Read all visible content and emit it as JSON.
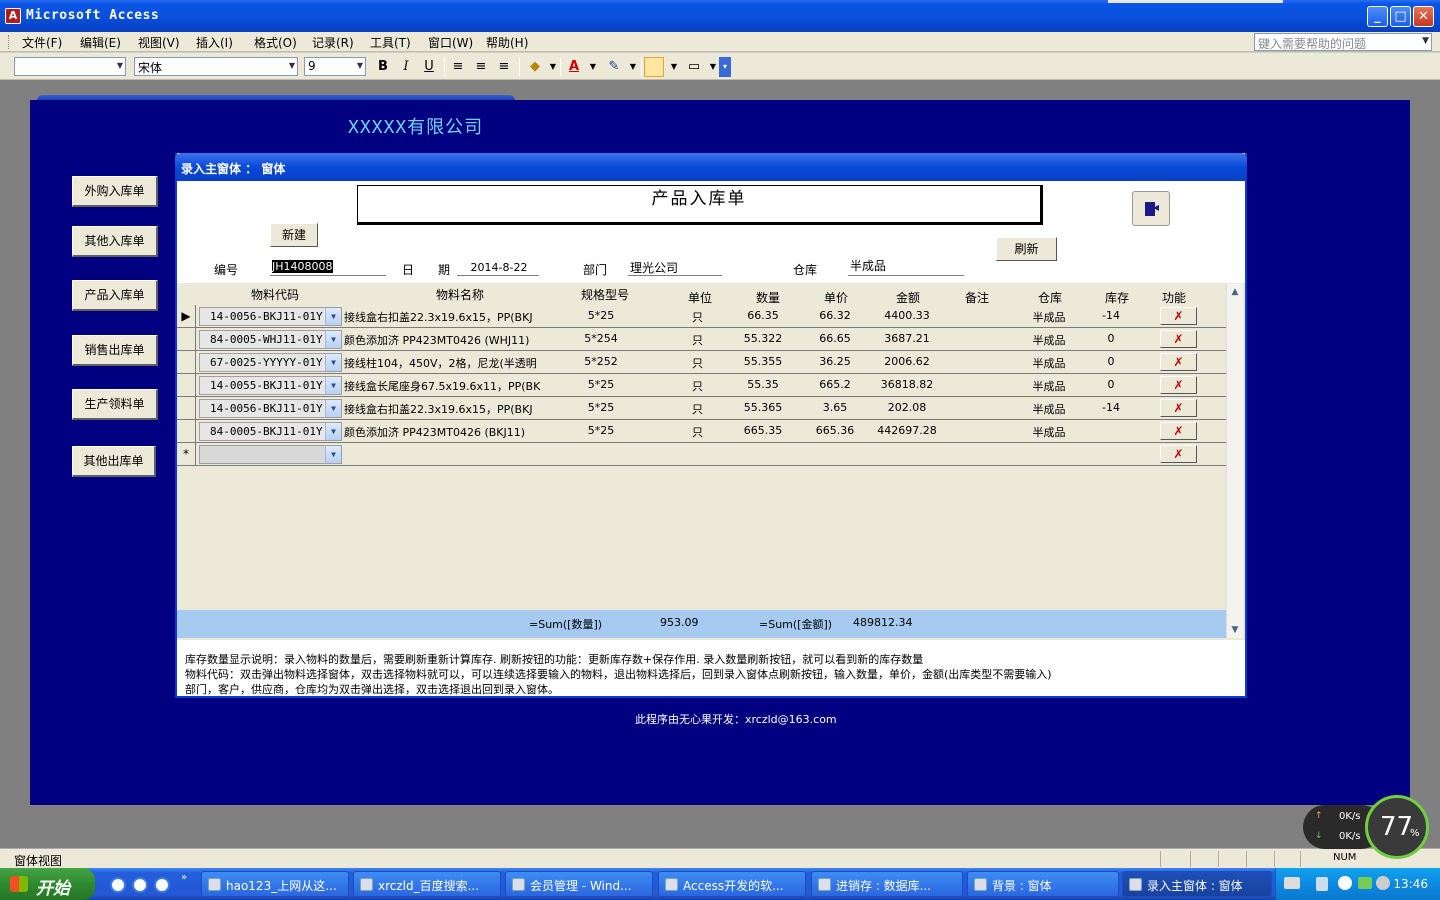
{
  "window": {
    "title": "Microsoft Access",
    "app_icon": "A"
  },
  "menu": {
    "items": [
      "文件(F)",
      "编辑(E)",
      "视图(V)",
      "插入(I)",
      "格式(O)",
      "记录(R)",
      "工具(T)",
      "窗口(W)",
      "帮助(H)"
    ],
    "help_placeholder": "键入需要帮助的问题"
  },
  "toolbar": {
    "object_combo": "",
    "font": "宋体",
    "size": "9",
    "bold": "B",
    "italic": "I",
    "underline": "U"
  },
  "background_form": {
    "company": "XXXXX有限公司",
    "footer": "此程序由无心果开发：xrczld@163.com"
  },
  "nav_buttons": [
    "外购入库单",
    "其他入库单",
    "产品入库单",
    "销售出库单",
    "生产领料单",
    "其他出库单"
  ],
  "form": {
    "window_title": "录入主窗体 ： 窗体",
    "title": "产品入库单",
    "new_button": "新建",
    "refresh_button": "刷新",
    "fields": {
      "code_label": "编号",
      "code_value": "JH1408008",
      "date_label_1": "日",
      "date_label_2": "期",
      "date_value": "2014-8-22",
      "dept_label": "部门",
      "dept_value": "理光公司",
      "warehouse_label": "仓库",
      "warehouse_value": "半成品"
    },
    "columns": [
      "物料代码",
      "物料名称",
      "规格型号",
      "单位",
      "数量",
      "单价",
      "金额",
      "备注",
      "仓库",
      "库存",
      "功能"
    ],
    "rows": [
      {
        "code": "14-0056-BKJ11-01Y",
        "name": "接线盒右扣盖22.3x19.6x15，PP(BKJ",
        "spec": "5*25",
        "unit": "只",
        "qty": "66.35",
        "price": "66.32",
        "amount": "4400.33",
        "note": "",
        "wh": "半成品",
        "stock": "-14"
      },
      {
        "code": "84-0005-WHJ11-01Y",
        "name": "颜色添加济 PP423MT0426 (WHJ11)",
        "spec": "5*254",
        "unit": "只",
        "qty": "55.322",
        "price": "66.65",
        "amount": "3687.21",
        "note": "",
        "wh": "半成品",
        "stock": "0"
      },
      {
        "code": "67-0025-YYYYY-01Y",
        "name": "接线柱104，450V，2格，尼龙(半透明",
        "spec": "5*252",
        "unit": "只",
        "qty": "55.355",
        "price": "36.25",
        "amount": "2006.62",
        "note": "",
        "wh": "半成品",
        "stock": "0"
      },
      {
        "code": "14-0055-BKJ11-01Y",
        "name": "接线盒长尾座身67.5x19.6x11，PP(BK",
        "spec": "5*25",
        "unit": "只",
        "qty": "55.35",
        "price": "665.2",
        "amount": "36818.82",
        "note": "",
        "wh": "半成品",
        "stock": "0"
      },
      {
        "code": "14-0056-BKJ11-01Y",
        "name": "接线盒右扣盖22.3x19.6x15，PP(BKJ",
        "spec": "5*25",
        "unit": "只",
        "qty": "55.365",
        "price": "3.65",
        "amount": "202.08",
        "note": "",
        "wh": "半成品",
        "stock": "-14"
      },
      {
        "code": "84-0005-BKJ11-01Y",
        "name": "颜色添加济 PP423MT0426 (BKJ11)",
        "spec": "5*25",
        "unit": "只",
        "qty": "665.35",
        "price": "665.36",
        "amount": "442697.28",
        "note": "",
        "wh": "半成品",
        "stock": ""
      }
    ],
    "current_row_marker": "▶",
    "new_row_marker": "*",
    "delete_icon_text": "✗",
    "sum": {
      "qty_label": "=Sum([数量])",
      "qty_value": "953.09",
      "amount_label": "=Sum([金额])",
      "amount_value": "489812.34"
    },
    "notes": [
      "库存数量显示说明：录入物料的数量后，需要刷新重新计算库存.       刷新按钮的功能：更新库存数+保存作用.       录入数量刷新按钮，就可以看到新的库存数量",
      "物料代码：双击弹出物料选择窗体，双击选择物料就可以，可以连续选择要输入的物料，退出物料选择后，回到录入窗体点刷新按钮，输入数量，单价，金额(出库类型不需要输入)",
      "部门，客户，供应商，仓库均为双击弹出选择，双击选择退出回到录入窗体。"
    ]
  },
  "statusbar": {
    "text": "窗体视图",
    "num": "NUM"
  },
  "net_widget": {
    "up": "0K/s",
    "down": "0K/s",
    "percent": "77",
    "percent_sign": "%"
  },
  "taskbar": {
    "start": "开始",
    "tasks": [
      "hao123_上网从这...",
      "xrczld_百度搜索...",
      "会员管理 - Wind...",
      "Access开发的软...",
      "进销存 : 数据库...",
      "背景 : 窗体",
      "录入主窗体 : 窗体"
    ],
    "clock": "13:46"
  }
}
